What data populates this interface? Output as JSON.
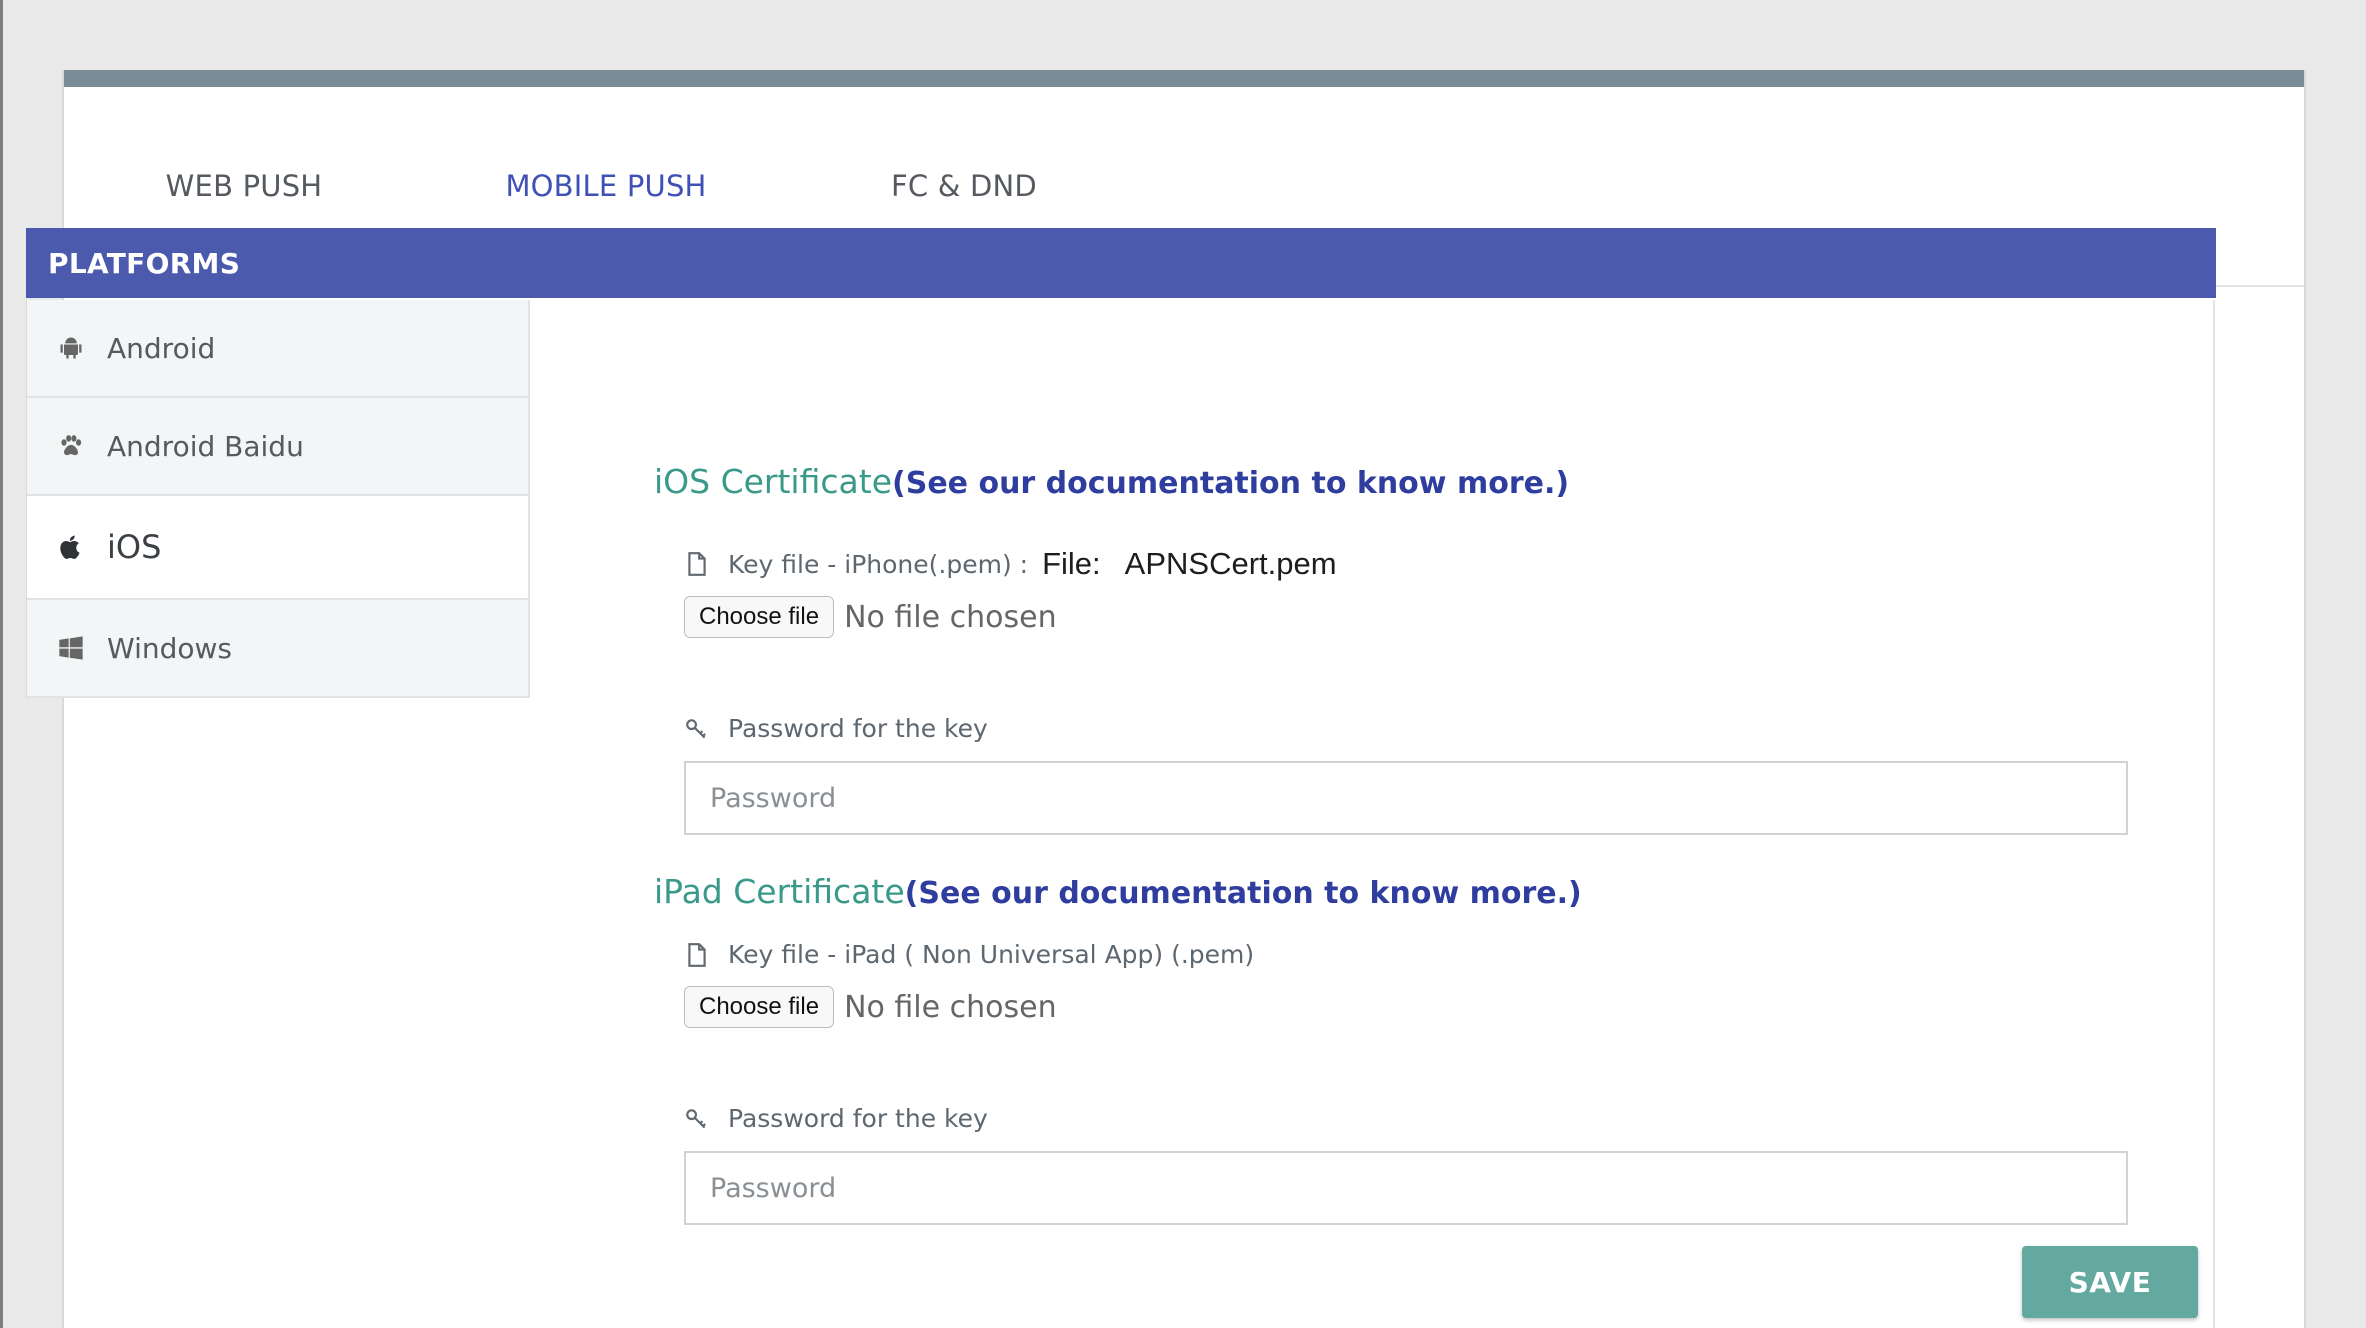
{
  "tabs": [
    {
      "label": "WEB PUSH"
    },
    {
      "label": "MOBILE PUSH"
    },
    {
      "label": "FC & DND"
    }
  ],
  "active_tab": "MOBILE PUSH",
  "platforms_header": "PLATFORMS",
  "sidebar": {
    "items": [
      {
        "label": "Android",
        "icon": "android-icon"
      },
      {
        "label": "Android Baidu",
        "icon": "paw-icon"
      },
      {
        "label": "iOS",
        "icon": "apple-icon"
      },
      {
        "label": "Windows",
        "icon": "windows-icon"
      }
    ],
    "active": "iOS"
  },
  "ios_section": {
    "title": "iOS Certificate",
    "doc_link": "(See our documentation to know more.)",
    "key_file_label": "Key file - iPhone(.pem) :",
    "current_file_prefix": "File:",
    "current_file_name": "APNSCert.pem",
    "choose_file_label": "Choose file",
    "no_file_text": "No file chosen",
    "password_label": "Password for the key",
    "password_placeholder": "Password"
  },
  "ipad_section": {
    "title": "iPad Certificate",
    "doc_link": "(See our documentation to know more.)",
    "key_file_label": "Key file - iPad ( Non Universal App) (.pem)",
    "choose_file_label": "Choose file",
    "no_file_text": "No file chosen",
    "password_label": "Password for the key",
    "password_placeholder": "Password"
  },
  "save_label": "SAVE",
  "colors": {
    "header_blue": "#4b5aad",
    "tab_active": "#3f51b5",
    "tab_underline": "#4fb0c6",
    "title_green": "#3a9a8a",
    "save_button": "#63a99f"
  }
}
